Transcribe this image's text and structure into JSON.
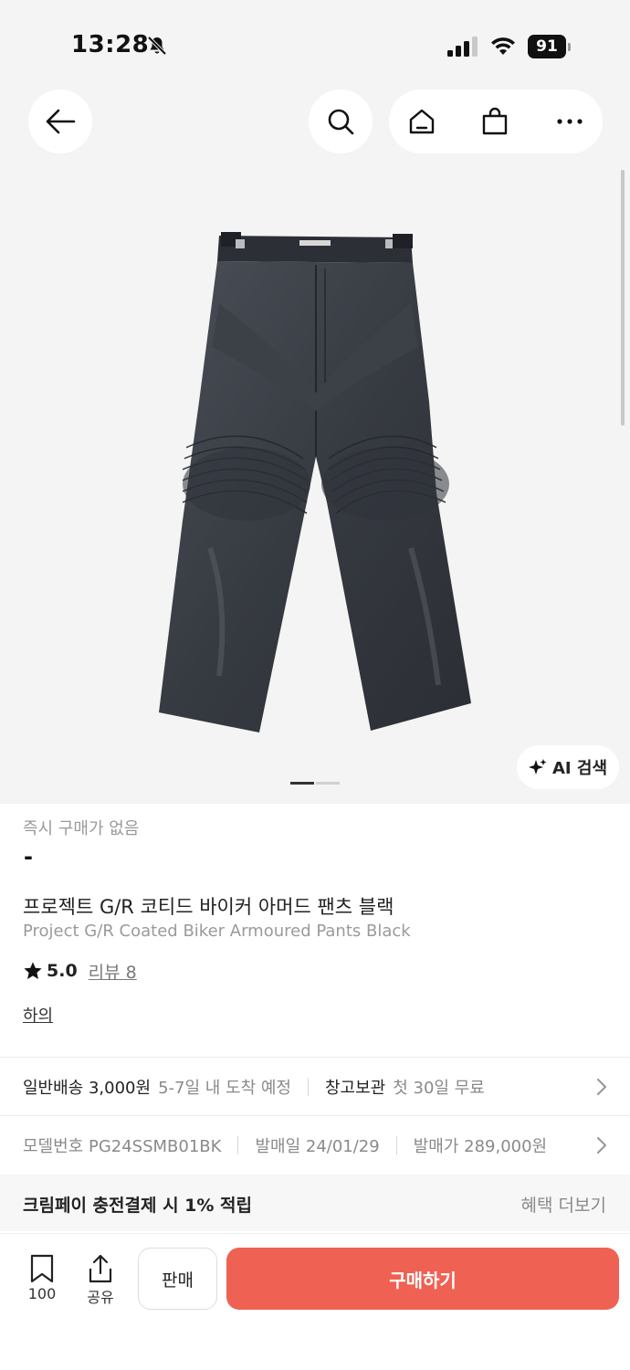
{
  "status_bar": {
    "time": "13:28",
    "battery": "91"
  },
  "product": {
    "availability": "즉시 구매가 없음",
    "price": "-",
    "name_ko": "프로젝트 G/R 코티드 바이커 아머드 팬츠 블랙",
    "name_en": "Project G/R Coated Biker Armoured Pants Black",
    "rating": "5.0",
    "review_link": "리뷰 8",
    "category": "하의",
    "image_count": 2,
    "image_index": 1
  },
  "ai_search": {
    "label": "AI 검색"
  },
  "delivery": {
    "normal_label": "일반배송 3,000원",
    "normal_eta": "5-7일 내 도착 예정",
    "storage_label": "창고보관",
    "storage_note": "첫 30일 무료"
  },
  "specs": {
    "model": "모델번호 PG24SSMB01BK",
    "release_date": "발매일 24/01/29",
    "release_price": "발매가 289,000원"
  },
  "benefit": {
    "text": "크림페이 충전결제 시 1% 적립",
    "more": "혜택 더보기"
  },
  "bottom": {
    "bookmark_count": "100",
    "share_label": "공유",
    "sell_label": "판매",
    "buy_label": "구매하기"
  },
  "colors": {
    "accent": "#ef6253",
    "background": "#f4f4f4"
  }
}
